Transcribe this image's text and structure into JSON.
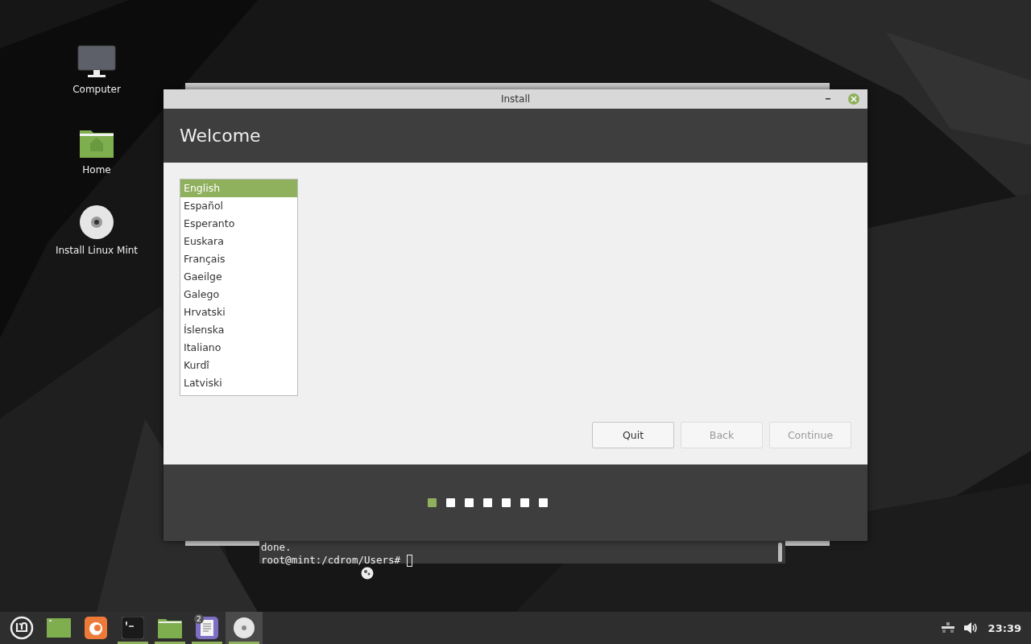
{
  "desktop_icons": [
    {
      "label": "Computer",
      "kind": "computer"
    },
    {
      "label": "Home",
      "kind": "home"
    },
    {
      "label": "Install Linux Mint",
      "kind": "disc"
    }
  ],
  "terminal": {
    "lines": [
      "done.",
      "root@mint:/cdrom/Users#"
    ]
  },
  "window": {
    "title": "Install",
    "heading": "Welcome",
    "languages": [
      {
        "label": "English",
        "selected": true
      },
      {
        "label": "Español",
        "selected": false
      },
      {
        "label": "Esperanto",
        "selected": false
      },
      {
        "label": "Euskara",
        "selected": false
      },
      {
        "label": "Français",
        "selected": false
      },
      {
        "label": "Gaeilge",
        "selected": false
      },
      {
        "label": "Galego",
        "selected": false
      },
      {
        "label": "Hrvatski",
        "selected": false
      },
      {
        "label": "Íslenska",
        "selected": false
      },
      {
        "label": "Italiano",
        "selected": false
      },
      {
        "label": "Kurdî",
        "selected": false
      },
      {
        "label": "Latviski",
        "selected": false
      }
    ],
    "buttons": [
      {
        "label": "Quit",
        "disabled": false
      },
      {
        "label": "Back",
        "disabled": true
      },
      {
        "label": "Continue",
        "disabled": true
      }
    ],
    "steps": [
      {
        "selected": true
      },
      {
        "selected": false
      },
      {
        "selected": false
      },
      {
        "selected": false
      },
      {
        "selected": false
      },
      {
        "selected": false
      },
      {
        "selected": false
      }
    ]
  },
  "taskbar": {
    "launchers": [
      {
        "kind": "menu",
        "running": false,
        "active": false
      },
      {
        "kind": "desktop",
        "running": false,
        "active": false
      },
      {
        "kind": "browser",
        "running": false,
        "active": false
      },
      {
        "kind": "terminal",
        "running": true,
        "active": false
      },
      {
        "kind": "folder",
        "running": true,
        "active": false
      },
      {
        "kind": "editor",
        "running": true,
        "active": false,
        "badge": "2"
      },
      {
        "kind": "disc",
        "running": true,
        "active": true
      }
    ],
    "clock": "23:39"
  }
}
